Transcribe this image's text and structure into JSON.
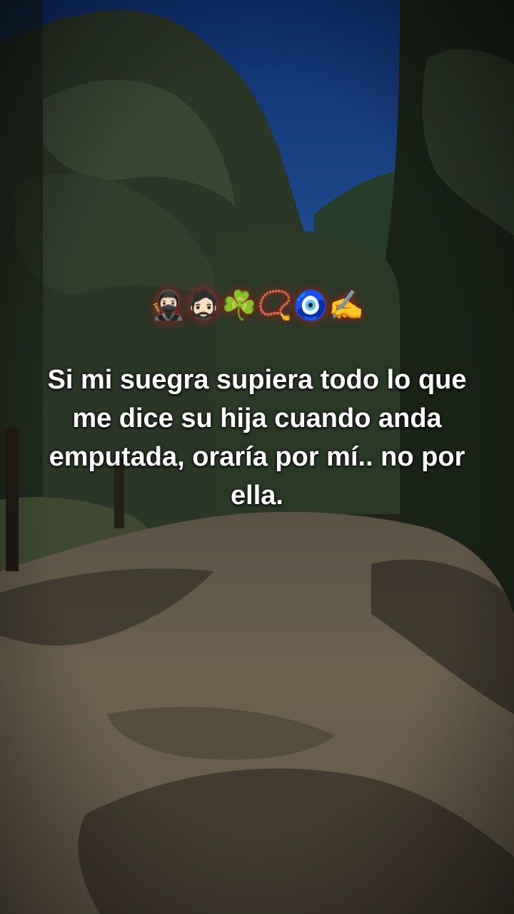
{
  "overlay": {
    "emojis": [
      "🥷🏻",
      "🧔🏻",
      "☘️",
      "📿",
      "🧿",
      "✍️"
    ],
    "caption": "Si mi suegra supiera todo lo que me dice su hija cuando anda emputada, oraría por mí.. no por ella."
  },
  "background": {
    "sky_color": "#1f4f9a",
    "tree_color": "#2b3a28",
    "road_color": "#8a7c66"
  },
  "icons": {
    "emoji_1": "ninja-emoji-icon",
    "emoji_2": "bearded-man-emoji-icon",
    "emoji_3": "shamrock-emoji-icon",
    "emoji_4": "prayer-beads-emoji-icon",
    "emoji_5": "nazar-amulet-emoji-icon",
    "emoji_6": "writing-hand-emoji-icon"
  }
}
